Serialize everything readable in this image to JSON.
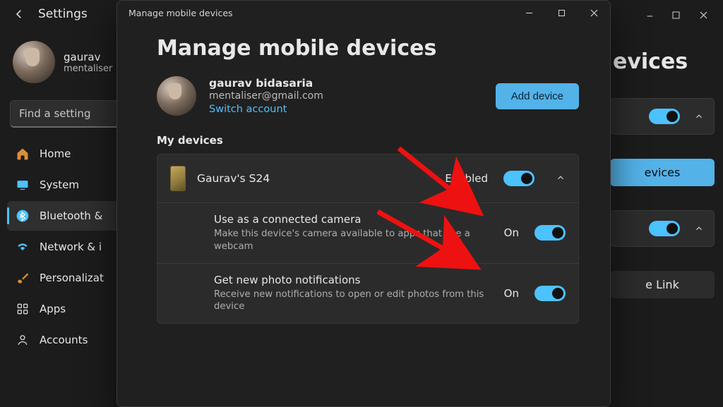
{
  "settings": {
    "title": "Settings",
    "profile_name": "gaurav",
    "profile_email": "mentaliser",
    "search_placeholder": "Find a setting",
    "nav": {
      "home": "Home",
      "system": "System",
      "bluetooth": "Bluetooth &",
      "network": "Network & i",
      "personalization": "Personalizat",
      "apps": "Apps",
      "accounts": "Accounts"
    }
  },
  "dialog": {
    "window_title": "Manage mobile devices",
    "heading": "Manage mobile devices",
    "account_name": "gaurav bidasaria",
    "account_email": "mentaliser@gmail.com",
    "switch_account": "Switch account",
    "add_device": "Add device",
    "my_devices": "My devices",
    "device_name": "Gaurav's S24",
    "enabled_label": "Enabled",
    "camera_title": "Use as a connected camera",
    "camera_desc": "Make this device's camera available to apps that use a webcam",
    "camera_state": "On",
    "photo_title": "Get new photo notifications",
    "photo_desc": "Receive new notifications to open or edit photos from this device",
    "photo_state": "On"
  },
  "bg": {
    "title_frag": "evices",
    "btn_frag": "evices",
    "link_frag": "e Link"
  }
}
